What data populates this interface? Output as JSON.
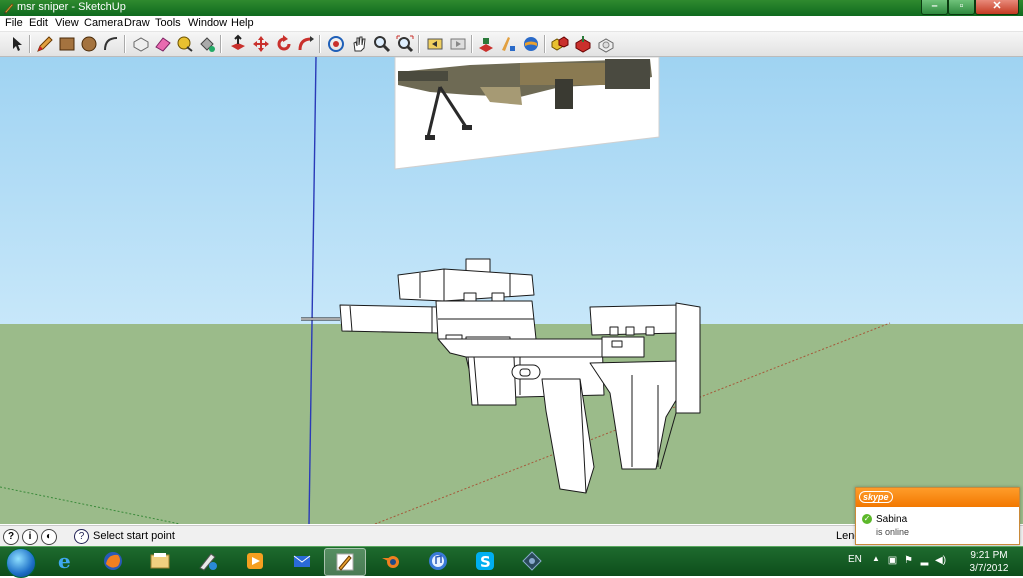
{
  "window": {
    "title": "msr sniper - SketchUp",
    "buttons": [
      "minimize",
      "maximize",
      "close"
    ]
  },
  "menu": [
    "File",
    "Edit",
    "View",
    "Camera",
    "Draw",
    "Tools",
    "Window",
    "Help"
  ],
  "toolbar": {
    "tools": [
      "select-icon",
      "pencil-icon",
      "rectangle-icon",
      "circle-icon",
      "arc-icon",
      "make-component-icon",
      "eraser-icon",
      "tape-measure-icon",
      "paint-bucket-icon",
      "push-pull-icon",
      "move-icon",
      "rotate-icon",
      "follow-me-icon",
      "orbit-icon",
      "pan-icon",
      "zoom-icon",
      "zoom-extents-icon",
      "previous-view-icon",
      "next-view-icon",
      "get-models-icon",
      "share-model-icon",
      "add-location-icon",
      "toggle-terrain-icon",
      "components-icon",
      "share-component-icon",
      "materials-icon"
    ]
  },
  "colors": {
    "sky_top": "#9fd3f2",
    "ground": "#9bbb8a",
    "titlebar": "#1c7a2c",
    "skype": "#f27800"
  },
  "status": {
    "prompt": "Select start point",
    "measurements_label": "Leng"
  },
  "skype": {
    "logo": "skype",
    "contact_name": "Sabina",
    "contact_status": "is online"
  },
  "taskbar": {
    "apps": [
      "internet-explorer-icon",
      "firefox-icon",
      "file-explorer-icon",
      "paint-icon",
      "media-player-icon",
      "live-mail-icon",
      "sketchup-icon",
      "blender-icon",
      "itunes-icon",
      "skype-icon",
      "network-icon"
    ],
    "active": "sketchup-icon",
    "language": "EN",
    "time": "9:21 PM",
    "date": "3/7/2012"
  }
}
